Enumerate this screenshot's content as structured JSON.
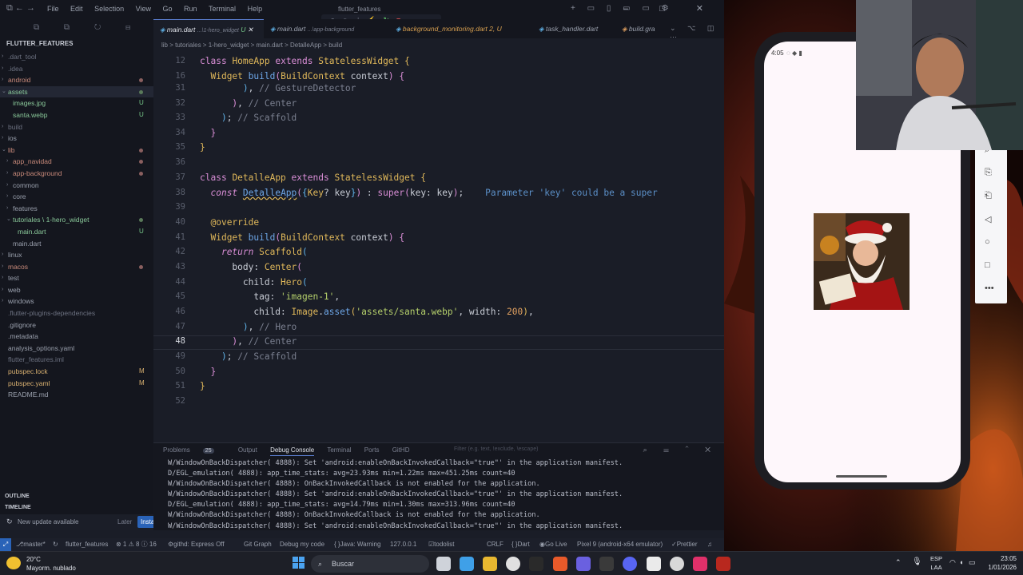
{
  "window": {
    "title": "flutter_features",
    "menu": [
      "File",
      "Edit",
      "Selection",
      "View",
      "Go",
      "Run",
      "Terminal",
      "Help"
    ]
  },
  "explorer": {
    "header": "FLUTTER_FEATURES",
    "items": [
      {
        "label": ".dart_tool",
        "status": ""
      },
      {
        "label": ".idea",
        "status": ""
      },
      {
        "label": "android",
        "status": "dot"
      },
      {
        "label": "assets",
        "status": "dotg"
      },
      {
        "label": "images.jpg",
        "status": "U"
      },
      {
        "label": "santa.webp",
        "status": "U"
      },
      {
        "label": "build",
        "status": ""
      },
      {
        "label": "ios",
        "status": ""
      },
      {
        "label": "lib",
        "status": "dot"
      },
      {
        "label": "app_navidad",
        "status": "dot"
      },
      {
        "label": "app-background",
        "status": "dot"
      },
      {
        "label": "common",
        "status": ""
      },
      {
        "label": "core",
        "status": ""
      },
      {
        "label": "features",
        "status": ""
      },
      {
        "label": "tutoriales \\ 1-hero_widget",
        "status": "dotg"
      },
      {
        "label": "main.dart",
        "status": "U"
      },
      {
        "label": "main.dart",
        "status": ""
      },
      {
        "label": "linux",
        "status": ""
      },
      {
        "label": "macos",
        "status": "dot"
      },
      {
        "label": "test",
        "status": ""
      },
      {
        "label": "web",
        "status": ""
      },
      {
        "label": "windows",
        "status": ""
      },
      {
        "label": ".flutter-plugins-dependencies",
        "status": ""
      },
      {
        "label": ".gitignore",
        "status": ""
      },
      {
        "label": ".metadata",
        "status": ""
      },
      {
        "label": "analysis_options.yaml",
        "status": ""
      },
      {
        "label": "flutter_features.iml",
        "status": ""
      },
      {
        "label": "pubspec.lock",
        "status": "M"
      },
      {
        "label": "pubspec.yaml",
        "status": "M"
      },
      {
        "label": "README.md",
        "status": ""
      }
    ],
    "outline": "OUTLINE",
    "timeline": "TIMELINE",
    "update_msg": "New update available",
    "later": "Later",
    "install": "Install Now"
  },
  "tabs": [
    {
      "label": "main.dart",
      "sub": "...\\1-hero_widget",
      "badge": "U"
    },
    {
      "label": "main.dart",
      "sub": "...\\app-background",
      "badge": ""
    },
    {
      "label": "background_monitoring.dart",
      "sub": "",
      "badge": "2, U"
    },
    {
      "label": "task_handler.dart",
      "sub": "",
      "badge": ""
    },
    {
      "label": "build.gra",
      "sub": "",
      "badge": ""
    }
  ],
  "breadcrumb": "lib > tutoriales > 1-hero_widget > main.dart > DetalleApp > build",
  "editor": {
    "line_numbers": [
      "12",
      "16",
      "31",
      "32",
      "33",
      "34",
      "35",
      "36",
      "37",
      "38",
      "39",
      "40",
      "41",
      "42",
      "43",
      "44",
      "45",
      "46",
      "47",
      "48",
      "49",
      "50",
      "51",
      "52"
    ],
    "inline_hint": "Parameter 'key' could be a super"
  },
  "panel": {
    "tabs": [
      "Problems",
      "Output",
      "Debug Console",
      "Terminal",
      "Ports",
      "GitHD"
    ],
    "problems_count": "25",
    "filter_placeholder": "Filter (e.g. text, !exclude, \\escape)",
    "log": [
      "W/WindowOnBackDispatcher( 4888): Set 'android:enableOnBackInvokedCallback=\"true\"' in the application manifest.",
      "D/EGL_emulation( 4888): app_time_stats: avg=23.93ms min=1.22ms max=451.25ms count=40",
      "W/WindowOnBackDispatcher( 4888): OnBackInvokedCallback is not enabled for the application.",
      "W/WindowOnBackDispatcher( 4888): Set 'android:enableOnBackInvokedCallback=\"true\"' in the application manifest.",
      "D/EGL_emulation( 4888): app_time_stats: avg=14.79ms min=1.30ms max=313.96ms count=40",
      "W/WindowOnBackDispatcher( 4888): OnBackInvokedCallback is not enabled for the application.",
      "W/WindowOnBackDispatcher( 4888): Set 'android:enableOnBackInvokedCallback=\"true\"' in the application manifest."
    ]
  },
  "status": {
    "branch": "master*",
    "project": "flutter_features",
    "problems": "⊗ 1 ⚠ 8 ⓘ 16",
    "github": "githd: Express Off",
    "gitgraph": "Git Graph",
    "debug": "Debug my code",
    "java": "Java: Warning",
    "host": "127.0.0.1",
    "todo": "todolist",
    "eol": "CRLF",
    "lang": "Dart",
    "golive": "Go Live",
    "device": "Pixel 9 (android-x64 emulator)",
    "prettier": "Prettier"
  },
  "phone": {
    "time": "4:05"
  },
  "taskbar": {
    "temp": "20°C",
    "weather": "Mayorm. nublado",
    "search": "Buscar",
    "lang1": "ESP",
    "lang2": "LAA",
    "time": "23:05",
    "date": "1/01/2026"
  }
}
